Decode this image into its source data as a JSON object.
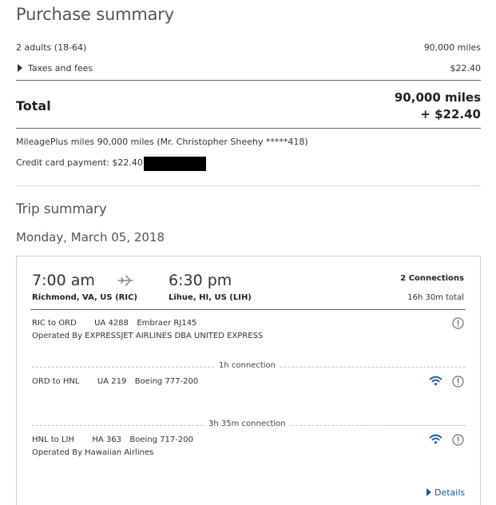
{
  "purchase": {
    "title": "Purchase summary",
    "passengers_label": "2 adults (18-64)",
    "passengers_value": "90,000 miles",
    "taxes_label": "Taxes and fees",
    "taxes_value": "$22.40",
    "total_label": "Total",
    "total_miles": "90,000 miles",
    "total_cash": "+ $22.40",
    "mileageplus_line": "MileagePlus miles 90,000 miles (Mr. Christopher Sheehy *****418)",
    "credit_line": "Credit card payment: $22.40"
  },
  "trip": {
    "title": "Trip summary",
    "date": "Monday, March 05, 2018",
    "depart_time": "7:00 am",
    "depart_place": "Richmond, VA, US (RIC)",
    "arrive_time": "6:30 pm",
    "arrive_place": "Lihue, HI, US (LIH)",
    "connections": "2 Connections",
    "duration": "16h 30m total",
    "segments": [
      {
        "route": "RIC to ORD",
        "flight": "UA 4288",
        "aircraft": "Embraer RJ145",
        "operated_by": "Operated By EXPRESSJET AIRLINES DBA UNITED EXPRESS"
      },
      {
        "route": "ORD to HNL",
        "flight": "UA 219",
        "aircraft": "Boeing 777-200"
      },
      {
        "route": "HNL to LIH",
        "flight": "HA 363",
        "aircraft": "Boeing 717-200",
        "operated_by": "Operated By Hawaiian Airlines"
      }
    ],
    "layovers": [
      {
        "label": "1h connection"
      },
      {
        "label": "3h 35m connection"
      }
    ],
    "details_link": "Details"
  },
  "colors": {
    "link_blue": "#1a5aa0",
    "text_dark": "#333333",
    "text_heading": "#555555",
    "border_light": "#cfcfcf"
  },
  "icons": [
    "caret-right-icon",
    "airplane-icon",
    "info-icon",
    "wifi-icon"
  ]
}
